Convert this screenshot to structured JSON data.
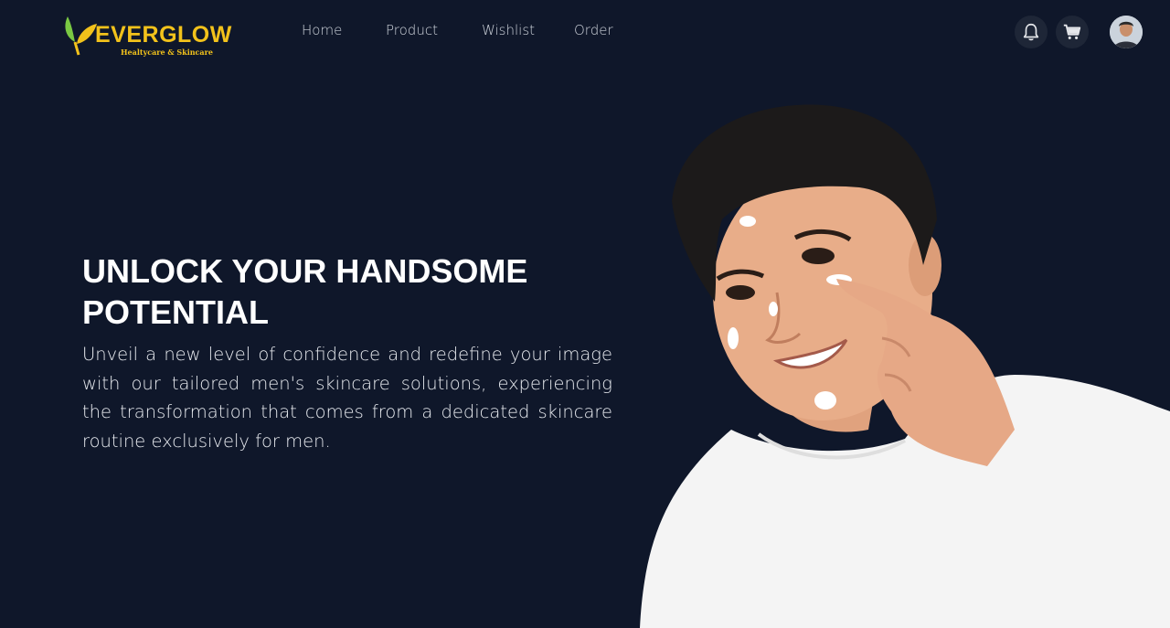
{
  "brand": {
    "name": "EVERGLOW",
    "tagline": "Healtycare & Skincare"
  },
  "nav": {
    "links": [
      "Home",
      "Product",
      "Wishlist",
      "Order"
    ]
  },
  "actions": {
    "notification_icon": "bell-icon",
    "cart_icon": "cart-icon",
    "avatar_icon": "user-avatar"
  },
  "hero": {
    "title": "UNLOCK YOUR HANDSOME POTENTIAL",
    "description": "Unveil a new level of confidence and redefine your image with our tailored men's skincare solutions, experiencing the transformation that comes from a dedicated skincare routine exclusively for men."
  },
  "colors": {
    "background": "#0f172a",
    "brand": "#f2c21b",
    "leaf_green": "#7ac943",
    "icon_bg": "#1e2637"
  }
}
